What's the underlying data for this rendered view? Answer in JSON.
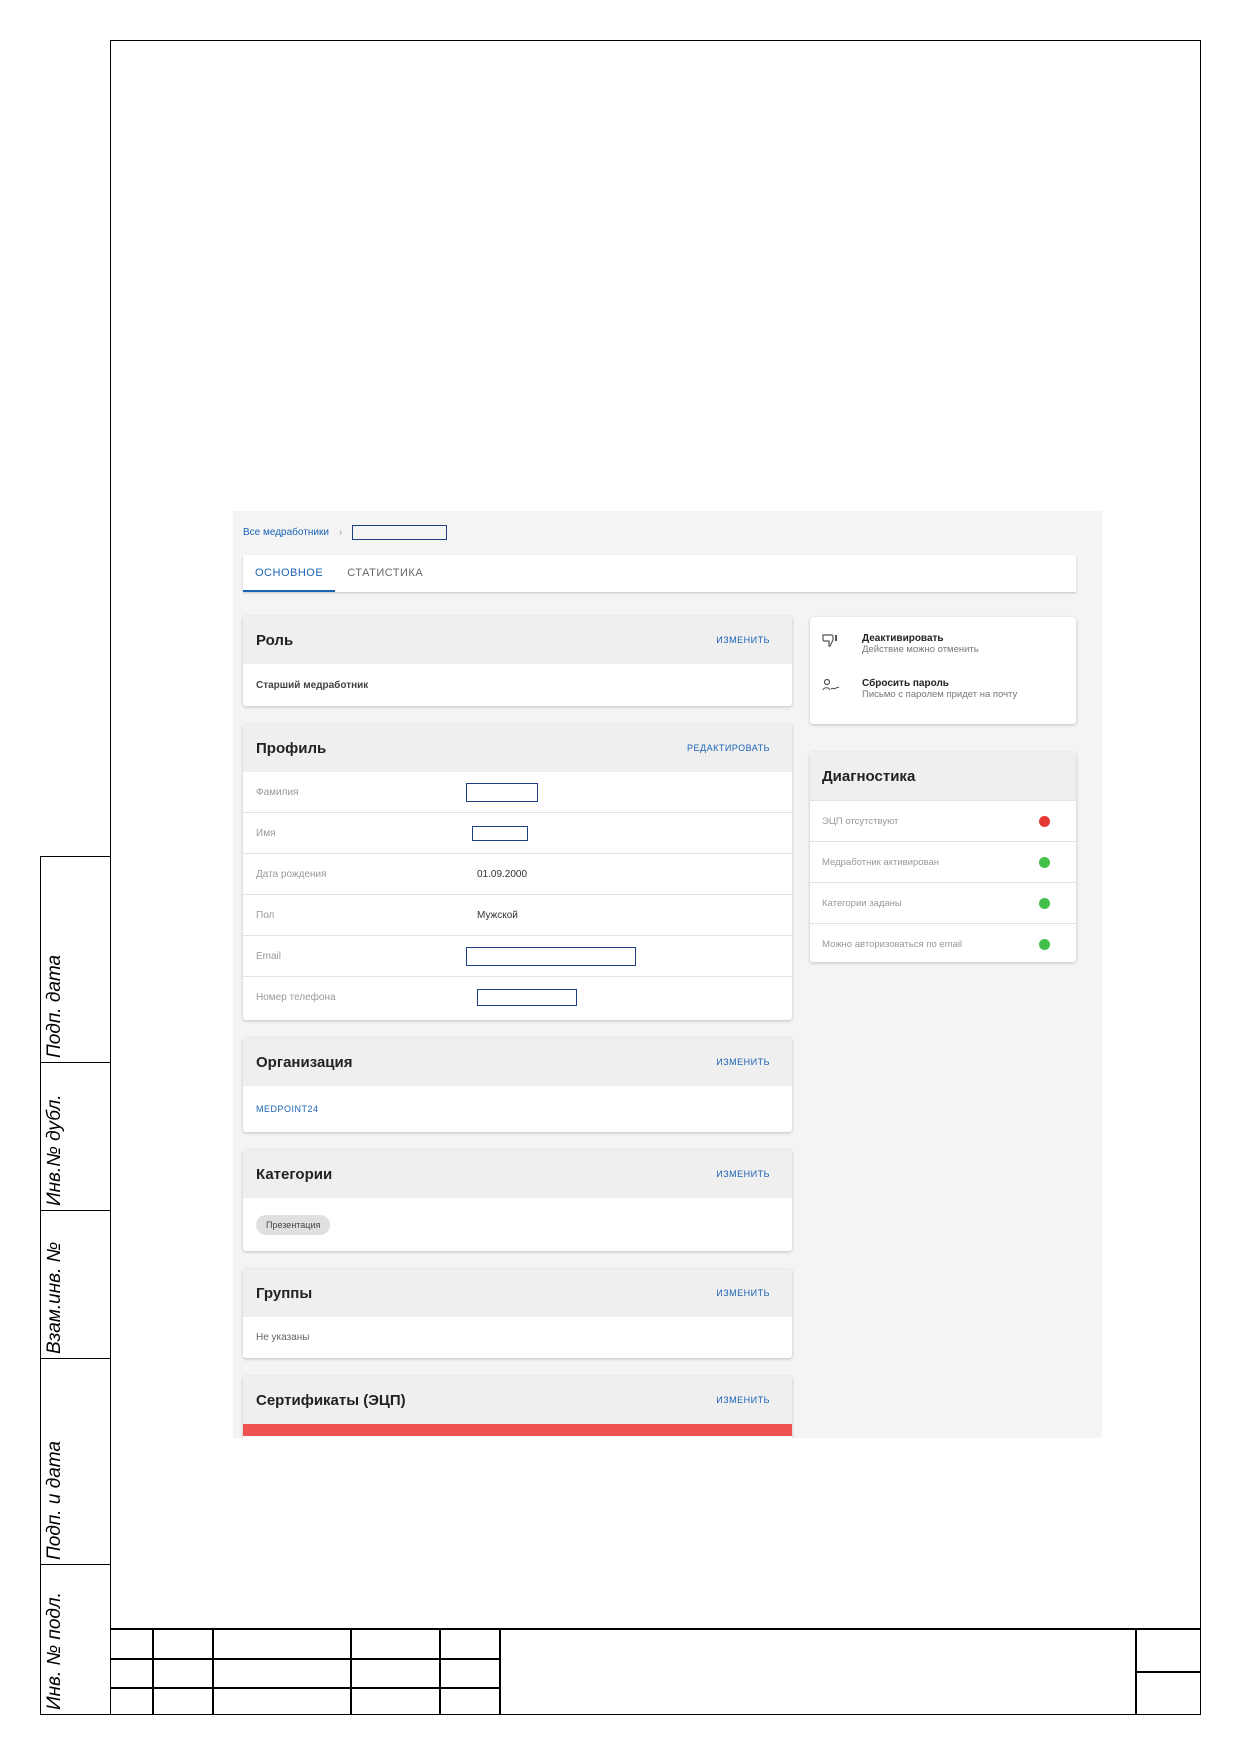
{
  "side_labels": [
    "Подп. дата",
    "Инв.№ дубл.",
    "Взам.инв. №",
    "Подп. и дата",
    "Инв. № подл."
  ],
  "breadcrumb": {
    "root": "Все медработники",
    "separator": "›"
  },
  "tabs": [
    {
      "label": "ОСНОВНОЕ",
      "active": true
    },
    {
      "label": "СТАТИСТИКА",
      "active": false
    }
  ],
  "role": {
    "title": "Роль",
    "action": "ИЗМЕНИТЬ",
    "value": "Старший медработник"
  },
  "profile": {
    "title": "Профиль",
    "action": "РЕДАКТИРОВАТЬ",
    "rows": [
      {
        "label": "Фамилия",
        "value": ""
      },
      {
        "label": "Имя",
        "value": ""
      },
      {
        "label": "Дата рождения",
        "value": "01.09.2000"
      },
      {
        "label": "Пол",
        "value": "Мужской"
      },
      {
        "label": "Email",
        "value": ""
      },
      {
        "label": "Номер телефона",
        "value": ""
      }
    ]
  },
  "organization": {
    "title": "Организация",
    "action": "ИЗМЕНИТЬ",
    "value": "MEDPOINT24"
  },
  "categories": {
    "title": "Категории",
    "action": "ИЗМЕНИТЬ",
    "chips": [
      "Презентация"
    ]
  },
  "groups": {
    "title": "Группы",
    "action": "ИЗМЕНИТЬ",
    "value": "Не указаны"
  },
  "certificates": {
    "title": "Сертификаты (ЭЦП)",
    "action": "ИЗМЕНИТЬ",
    "accent": "#ef5350"
  },
  "actions": [
    {
      "icon": "thumb-down-icon",
      "glyph": "👎",
      "title": "Деактивировать",
      "subtitle": "Действие можно отменить"
    },
    {
      "icon": "password-reset-icon",
      "glyph": "✍",
      "title": "Сбросить пароль",
      "subtitle": "Письмо с паролем придет на почту"
    }
  ],
  "diagnostics": {
    "title": "Диагностика",
    "items": [
      {
        "label": "ЭЦП отсутствуют",
        "status": "error",
        "color": "#e53935"
      },
      {
        "label": "Медработник активирован",
        "status": "ok",
        "color": "#43c04a"
      },
      {
        "label": "Категории заданы",
        "status": "ok",
        "color": "#43c04a"
      },
      {
        "label": "Можно авторизоваться по email",
        "status": "ok",
        "color": "#43c04a"
      }
    ]
  }
}
